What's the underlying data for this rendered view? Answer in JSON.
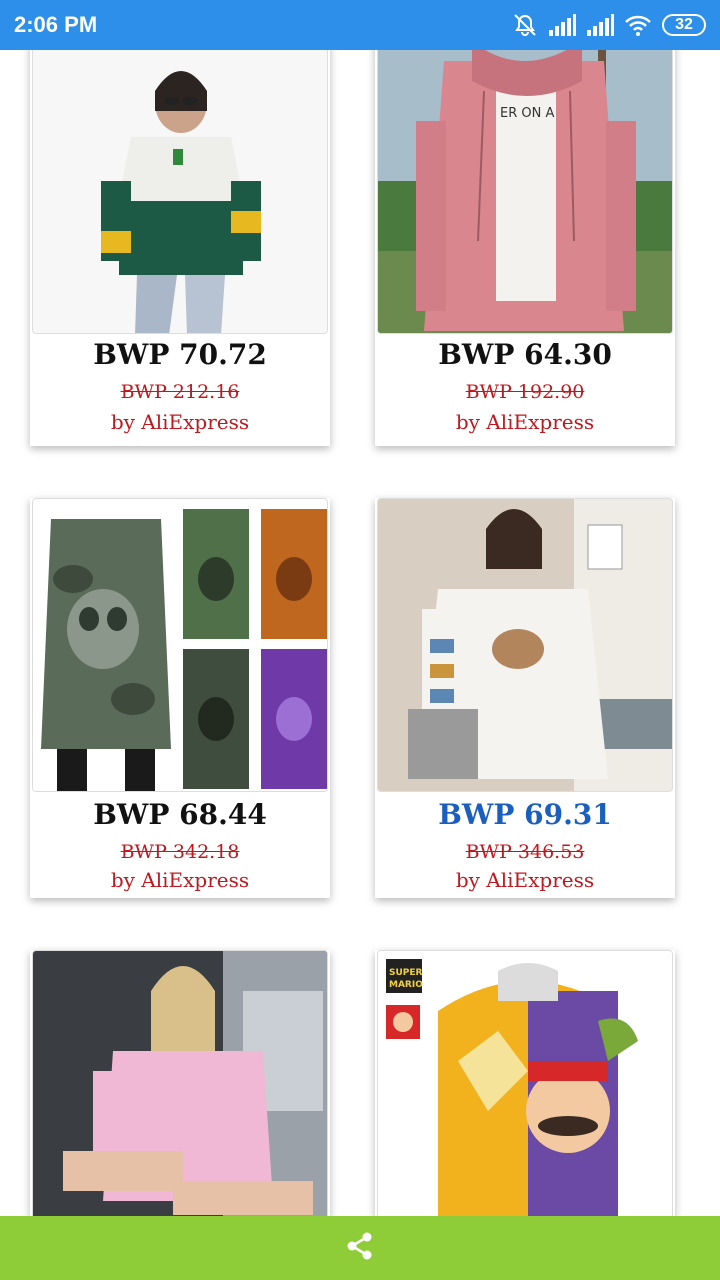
{
  "status": {
    "time": "2:06 PM",
    "battery": "32",
    "icons": [
      "mute-icon",
      "signal-icon",
      "signal-icon",
      "wifi-icon",
      "battery-icon"
    ]
  },
  "products": [
    {
      "price": "BWP 70.72",
      "old_price": "BWP 212.16",
      "seller": "by AliExpress",
      "image": "woman in green and white cactus hoodie"
    },
    {
      "price": "BWP 64.30",
      "old_price": "BWP 192.90",
      "seller": "by AliExpress",
      "image": "woman in pink zip hoodie"
    },
    {
      "price": "BWP 68.44",
      "old_price": "BWP 342.18",
      "seller": "by AliExpress",
      "image": "camo skull hoodie dresses"
    },
    {
      "price": "BWP 69.31",
      "old_price": "BWP 346.53",
      "seller": "by AliExpress",
      "image": "woman in white bear sweatshirt"
    },
    {
      "price": "",
      "old_price": "",
      "seller": "",
      "image": "woman in pink sweatshirt in car"
    },
    {
      "price": "",
      "old_price": "",
      "seller": "",
      "image": "super mario run hoodie"
    }
  ],
  "colors": {
    "status_bar": "#2d8fe9",
    "bottom_bar": "#8fcd38",
    "discount_red": "#c0181e",
    "highlight_blue": "#1a5fc0"
  },
  "bottom_bar": {
    "icon": "share-icon"
  }
}
